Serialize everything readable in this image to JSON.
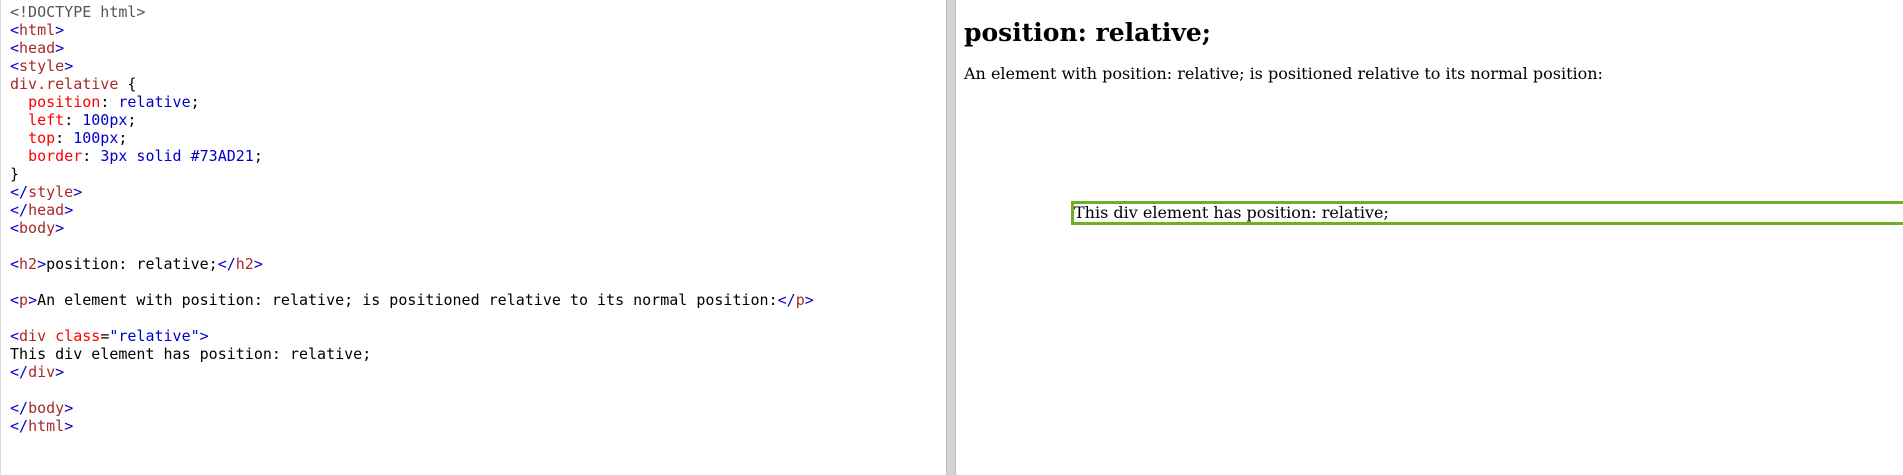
{
  "editor": {
    "lines": [
      [
        {
          "t": "<!DOCTYPE html>",
          "c": "doctype"
        }
      ],
      [
        {
          "t": "<",
          "c": "br"
        },
        {
          "t": "html",
          "c": "tag"
        },
        {
          "t": ">",
          "c": "br"
        }
      ],
      [
        {
          "t": "<",
          "c": "br"
        },
        {
          "t": "head",
          "c": "tag"
        },
        {
          "t": ">",
          "c": "br"
        }
      ],
      [
        {
          "t": "<",
          "c": "br"
        },
        {
          "t": "style",
          "c": "tag"
        },
        {
          "t": ">",
          "c": "br"
        }
      ],
      [
        {
          "t": "div.relative",
          "c": "sel"
        },
        {
          "t": " {",
          "c": "plain"
        }
      ],
      [
        {
          "t": "  ",
          "c": "plain"
        },
        {
          "t": "position",
          "c": "prop"
        },
        {
          "t": ": ",
          "c": "plain"
        },
        {
          "t": "relative",
          "c": "pv"
        },
        {
          "t": ";",
          "c": "plain"
        }
      ],
      [
        {
          "t": "  ",
          "c": "plain"
        },
        {
          "t": "left",
          "c": "prop"
        },
        {
          "t": ": ",
          "c": "plain"
        },
        {
          "t": "100px",
          "c": "pv"
        },
        {
          "t": ";",
          "c": "plain"
        }
      ],
      [
        {
          "t": "  ",
          "c": "plain"
        },
        {
          "t": "top",
          "c": "prop"
        },
        {
          "t": ": ",
          "c": "plain"
        },
        {
          "t": "100px",
          "c": "pv"
        },
        {
          "t": ";",
          "c": "plain"
        }
      ],
      [
        {
          "t": "  ",
          "c": "plain"
        },
        {
          "t": "border",
          "c": "prop"
        },
        {
          "t": ": ",
          "c": "plain"
        },
        {
          "t": "3px solid #73AD21",
          "c": "pv"
        },
        {
          "t": ";",
          "c": "plain"
        }
      ],
      [
        {
          "t": "}",
          "c": "plain"
        }
      ],
      [
        {
          "t": "</",
          "c": "br"
        },
        {
          "t": "style",
          "c": "tag"
        },
        {
          "t": ">",
          "c": "br"
        }
      ],
      [
        {
          "t": "</",
          "c": "br"
        },
        {
          "t": "head",
          "c": "tag"
        },
        {
          "t": ">",
          "c": "br"
        }
      ],
      [
        {
          "t": "<",
          "c": "br"
        },
        {
          "t": "body",
          "c": "tag"
        },
        {
          "t": ">",
          "c": "br"
        }
      ],
      [],
      [
        {
          "t": "<",
          "c": "br"
        },
        {
          "t": "h2",
          "c": "tag"
        },
        {
          "t": ">",
          "c": "br"
        },
        {
          "t": "position: relative;",
          "c": "plain"
        },
        {
          "t": "</",
          "c": "br"
        },
        {
          "t": "h2",
          "c": "tag"
        },
        {
          "t": ">",
          "c": "br"
        }
      ],
      [],
      [
        {
          "t": "<",
          "c": "br"
        },
        {
          "t": "p",
          "c": "tag"
        },
        {
          "t": ">",
          "c": "br"
        },
        {
          "t": "An element with position: relative; is positioned relative to its normal position:",
          "c": "plain"
        },
        {
          "t": "</",
          "c": "br"
        },
        {
          "t": "p",
          "c": "tag"
        },
        {
          "t": ">",
          "c": "br"
        }
      ],
      [],
      [
        {
          "t": "<",
          "c": "br"
        },
        {
          "t": "div",
          "c": "tag"
        },
        {
          "t": " ",
          "c": "plain"
        },
        {
          "t": "class",
          "c": "attr"
        },
        {
          "t": "=",
          "c": "plain"
        },
        {
          "t": "\"relative\"",
          "c": "val"
        },
        {
          "t": ">",
          "c": "br"
        }
      ],
      [
        {
          "t": "This div element has position: relative;",
          "c": "plain"
        }
      ],
      [
        {
          "t": "</",
          "c": "br"
        },
        {
          "t": "div",
          "c": "tag"
        },
        {
          "t": ">",
          "c": "br"
        }
      ],
      [],
      [
        {
          "t": "</",
          "c": "br"
        },
        {
          "t": "body",
          "c": "tag"
        },
        {
          "t": ">",
          "c": "br"
        }
      ],
      [
        {
          "t": "</",
          "c": "br"
        },
        {
          "t": "html",
          "c": "tag"
        },
        {
          "t": ">",
          "c": "br"
        }
      ]
    ]
  },
  "result": {
    "heading": "position: relative;",
    "paragraph": "An element with position: relative; is positioned relative to its normal position:",
    "box_text": "This div element has position: relative;",
    "box_border_color": "#73AD21"
  },
  "colors": {
    "tag": "#a52a2a",
    "bracket": "#0000cd",
    "attribute": "#ff0000",
    "value": "#0000cd",
    "splitter": "#d3d3d3"
  }
}
